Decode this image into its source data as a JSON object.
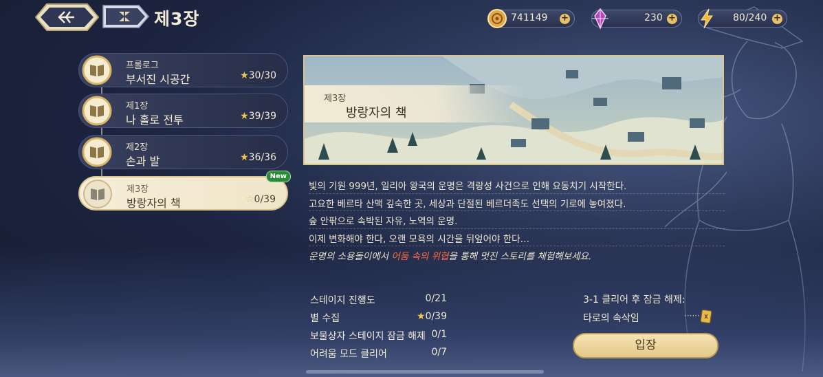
{
  "header": {
    "title": "제3장",
    "back_icon": "back-arrow-icon",
    "menu_icon": "grid-menu-icon"
  },
  "resources": [
    {
      "name": "gold",
      "icon": "coin-icon",
      "value": "741149"
    },
    {
      "name": "crystal",
      "icon": "crystal-icon",
      "value": "230"
    },
    {
      "name": "stamina",
      "icon": "lightning-icon",
      "value": "80/240"
    }
  ],
  "chapters": [
    {
      "subtitle": "프롤로그",
      "name": "부서진 시공간",
      "stars": "30/30"
    },
    {
      "subtitle": "제1장",
      "name": "나 홀로 전투",
      "stars": "39/39"
    },
    {
      "subtitle": "제2장",
      "name": "손과 발",
      "stars": "36/36"
    },
    {
      "subtitle": "제3장",
      "name": "방랑자의 책",
      "stars": "0/39",
      "badge": "New"
    }
  ],
  "banner": {
    "chapter": "제3장",
    "title": "방랑자의 책"
  },
  "description": {
    "lines": [
      "빛의 기원 999년, 일리아 왕국의 운명은 격랑성 사건으로 인해 요동치기 시작한다.",
      "고요한 베르타 산맥 깊숙한 곳, 세상과 단절된 베르더족도 선택의 기로에 놓여졌다.",
      "숲 안팎으로 속박된 자유, 노역의 운명.",
      "이제 변화해야 한다, 오랜 모욕의 시간을 뒤엎어야 한다…"
    ],
    "hint_before": "운명의 소용돌이에서 ",
    "hint_highlight": "어둠 속의 위협",
    "hint_after": "을 통해 멋진 스토리를 체험해보세요."
  },
  "stats": [
    {
      "label": "스테이지 진행도",
      "value": "0/21"
    },
    {
      "label": "별 수집",
      "value": "0/39"
    },
    {
      "label": "보물상자 스테이지 잠금 해제",
      "value": "0/1"
    },
    {
      "label": "어려움 모드 클리어",
      "value": "0/7"
    }
  ],
  "unlock": {
    "title": "3-1 클리어 후 잠금 해제:",
    "item": "타로의 속삭임",
    "dots": "······"
  },
  "enter_button": "입장",
  "colors": {
    "gold_accent": "#e8c26a",
    "highlight": "#ff6a3c",
    "panel_cream": "#f6eed8"
  }
}
